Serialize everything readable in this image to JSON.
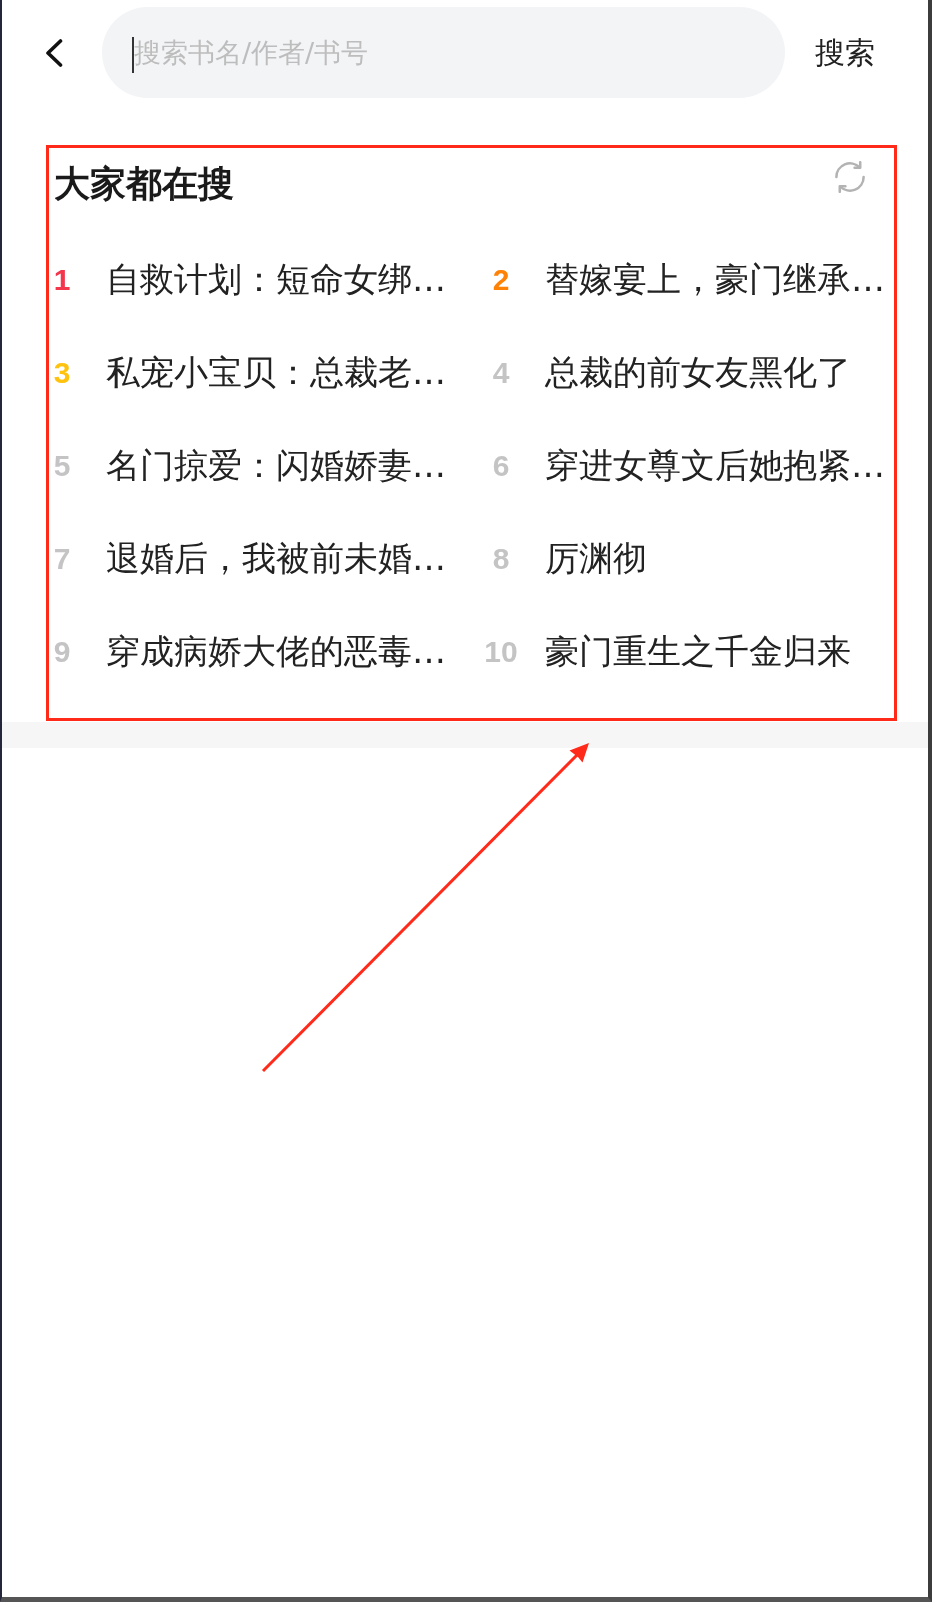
{
  "search": {
    "placeholder": "搜索书名/作者/书号",
    "focused": true,
    "button": "搜索"
  },
  "hot_searches": {
    "title": "大家都在搜",
    "highlighted": true,
    "items": [
      {
        "rank": "1",
        "title": "自救计划：短命女绑…",
        "color": "#f4364c"
      },
      {
        "rank": "2",
        "title": "替嫁宴上，豪门继承…",
        "color": "#ff8106"
      },
      {
        "rank": "3",
        "title": "私宠小宝贝：总裁老…",
        "color": "#ffc20e"
      },
      {
        "rank": "4",
        "title": "总裁的前女友黑化了",
        "color": "#c4c4c4"
      },
      {
        "rank": "5",
        "title": "名门掠爱：闪婚娇妻…",
        "color": "#c4c4c4"
      },
      {
        "rank": "6",
        "title": "穿进女尊文后她抱紧…",
        "color": "#c4c4c4"
      },
      {
        "rank": "7",
        "title": "退婚后，我被前未婚…",
        "color": "#c4c4c4"
      },
      {
        "rank": "8",
        "title": "厉渊彻",
        "color": "#c4c4c4"
      },
      {
        "rank": "9",
        "title": "穿成病娇大佬的恶毒…",
        "color": "#c4c4c4"
      },
      {
        "rank": "10",
        "title": "豪门重生之千金归来",
        "color": "#c4c4c4"
      }
    ]
  }
}
